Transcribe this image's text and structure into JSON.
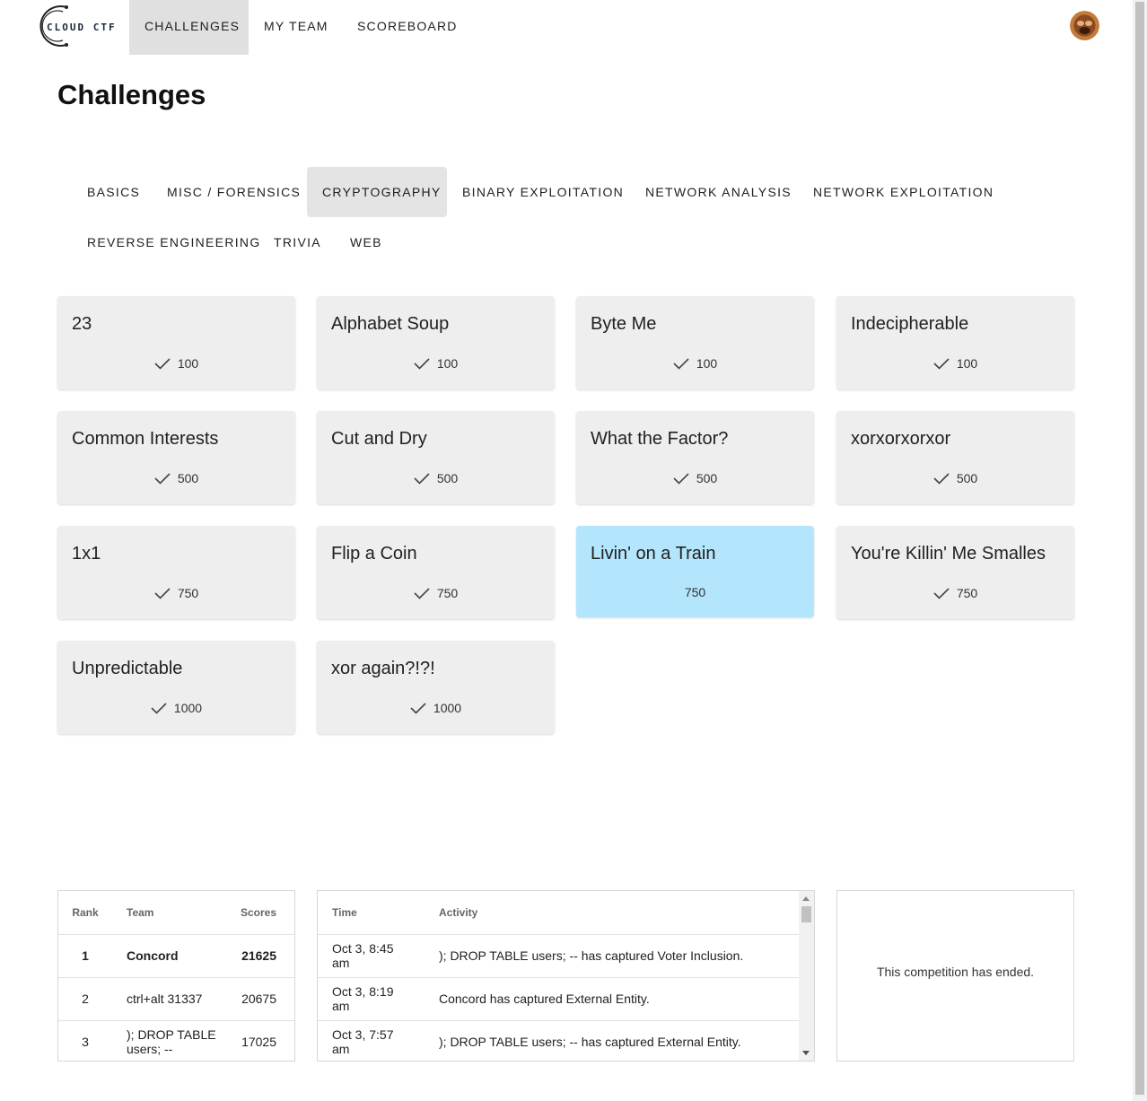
{
  "brand": {
    "logo_text": "CLOUD CTF"
  },
  "nav": {
    "items": [
      {
        "label": "CHALLENGES"
      },
      {
        "label": "MY TEAM"
      },
      {
        "label": "SCOREBOARD"
      }
    ],
    "active_index": 0
  },
  "page": {
    "title": "Challenges"
  },
  "categories": {
    "items": [
      {
        "label": "BASICS"
      },
      {
        "label": "MISC / FORENSICS"
      },
      {
        "label": "CRYPTOGRAPHY"
      },
      {
        "label": "BINARY EXPLOITATION"
      },
      {
        "label": "NETWORK ANALYSIS"
      },
      {
        "label": "NETWORK EXPLOITATION"
      },
      {
        "label": "REVERSE ENGINEERING"
      },
      {
        "label": "TRIVIA"
      },
      {
        "label": "WEB"
      }
    ],
    "active_index": 2
  },
  "challenges": [
    {
      "title": "23",
      "points": "100",
      "solved": true
    },
    {
      "title": "Alphabet Soup",
      "points": "100",
      "solved": true
    },
    {
      "title": "Byte Me",
      "points": "100",
      "solved": true
    },
    {
      "title": "Indecipherable",
      "points": "100",
      "solved": true
    },
    {
      "title": "Common Interests",
      "points": "500",
      "solved": true
    },
    {
      "title": "Cut and Dry",
      "points": "500",
      "solved": true
    },
    {
      "title": "What the Factor?",
      "points": "500",
      "solved": true
    },
    {
      "title": "xorxorxorxor",
      "points": "500",
      "solved": true
    },
    {
      "title": "1x1",
      "points": "750",
      "solved": true
    },
    {
      "title": "Flip a Coin",
      "points": "750",
      "solved": true
    },
    {
      "title": "Livin' on a Train",
      "points": "750",
      "solved": false
    },
    {
      "title": "You're Killin' Me Smalles",
      "points": "750",
      "solved": true
    },
    {
      "title": "Unpredictable",
      "points": "1000",
      "solved": true
    },
    {
      "title": "xor again?!?!",
      "points": "1000",
      "solved": true
    }
  ],
  "colors": {
    "unsolved_card": "#b3e5fc",
    "solved_card": "#eeeeee",
    "active_tab": "#e0e0e0"
  },
  "scoreboard": {
    "headers": {
      "rank": "Rank",
      "team": "Team",
      "score": "Scores"
    },
    "rows": [
      {
        "rank": "1",
        "team": "Concord",
        "score": "21625"
      },
      {
        "rank": "2",
        "team": "ctrl+alt 31337",
        "score": "20675"
      },
      {
        "rank": "3",
        "team": "); DROP TABLE users; --",
        "score": "17025"
      }
    ]
  },
  "activity": {
    "headers": {
      "time": "Time",
      "activity": "Activity"
    },
    "rows": [
      {
        "time": "Oct 3, 8:45 am",
        "text": "); DROP TABLE users; -- has captured Voter Inclusion."
      },
      {
        "time": "Oct 3, 8:19 am",
        "text": "Concord has captured External Entity."
      },
      {
        "time": "Oct 3, 7:57 am",
        "text": "); DROP TABLE users; -- has captured External Entity."
      }
    ]
  },
  "status": {
    "message": "This competition has ended."
  }
}
